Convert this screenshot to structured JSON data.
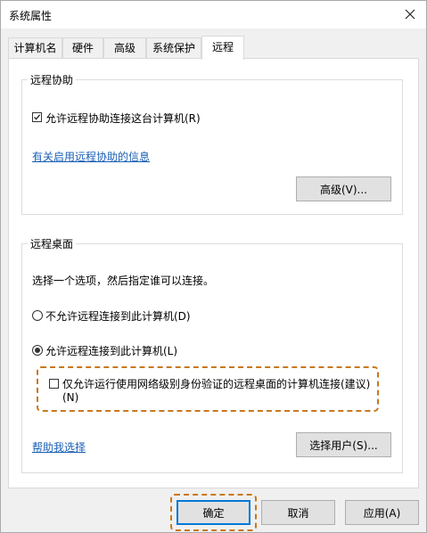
{
  "window": {
    "title": "系统属性"
  },
  "tabs": [
    {
      "label": "计算机名"
    },
    {
      "label": "硬件"
    },
    {
      "label": "高级"
    },
    {
      "label": "系统保护"
    },
    {
      "label": "远程"
    }
  ],
  "remote_assistance": {
    "legend": "远程协助",
    "allow_label": "允许远程协助连接这台计算机(R)",
    "allow_checked": true,
    "info_link": "有关启用远程协助的信息",
    "advanced_button": "高级(V)..."
  },
  "remote_desktop": {
    "legend": "远程桌面",
    "instruction": "选择一个选项，然后指定谁可以连接。",
    "option_deny": "不允许远程连接到此计算机(D)",
    "option_allow": "允许远程连接到此计算机(L)",
    "selected": "allow",
    "nla_line1": "仅允许运行使用网络级别身份验证的远程桌面的计算机连接(建议)",
    "nla_line2": "(N)",
    "nla_checked": false,
    "help_link": "帮助我选择",
    "select_users_button": "选择用户(S)..."
  },
  "footer": {
    "ok": "确定",
    "cancel": "取消",
    "apply": "应用(A)"
  },
  "colors": {
    "highlight": "#c8781e",
    "link": "#1a5fb4",
    "default_button_border": "#0078d7"
  }
}
